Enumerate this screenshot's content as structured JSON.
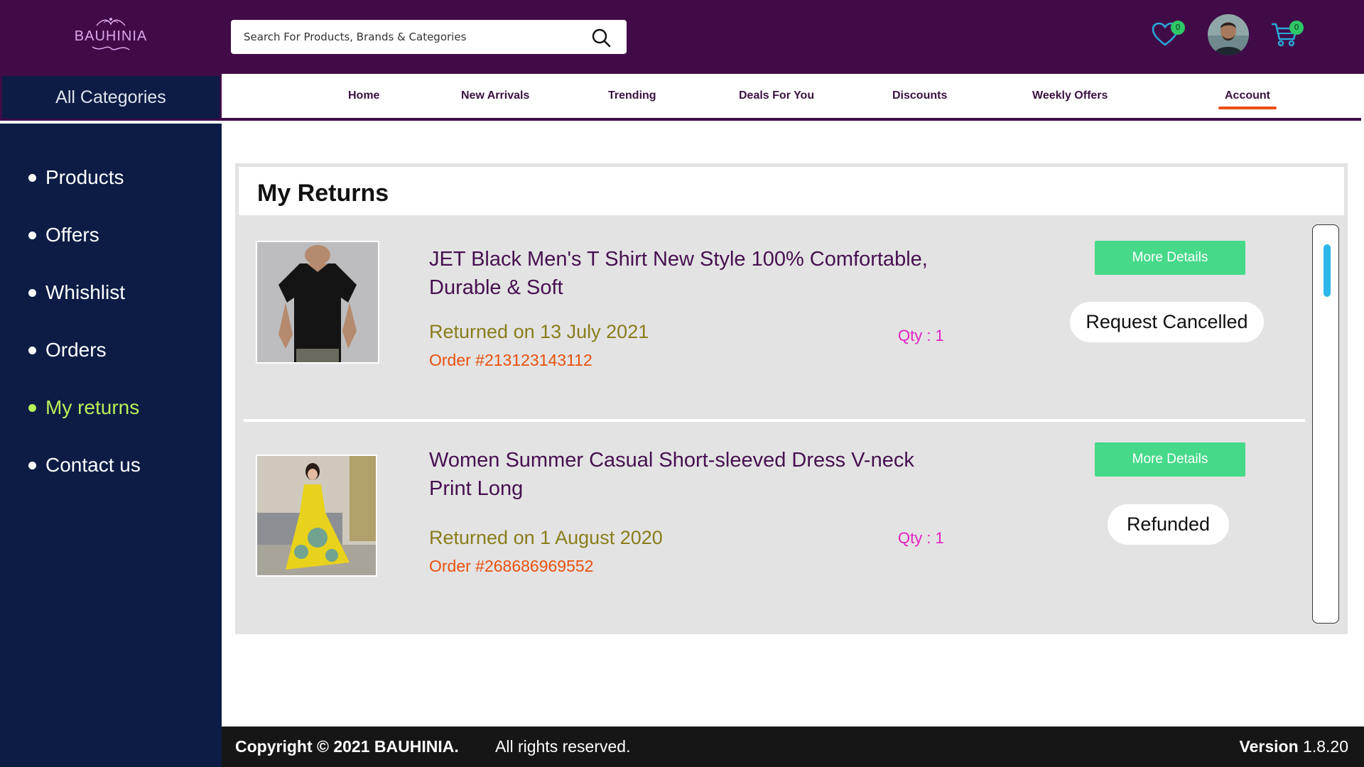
{
  "brand": {
    "name": "BAUHINIA"
  },
  "search": {
    "placeholder": "Search For Products, Brands & Categories"
  },
  "header": {
    "wishlist_count": "0",
    "cart_count": "0"
  },
  "all_categories": "All Categories",
  "nav": {
    "items": [
      "Home",
      "New Arrivals",
      "Trending",
      "Deals For You",
      "Discounts",
      "Weekly Offers",
      "Account"
    ],
    "active": "Account"
  },
  "sidebar": {
    "items": [
      "Products",
      "Offers",
      "Whishlist",
      "Orders",
      "My returns",
      "Contact us"
    ],
    "active": "My returns"
  },
  "returns": {
    "title": "My Returns",
    "items": [
      {
        "title": "JET Black Men's T Shirt New Style 100% Comfortable, Durable & Soft",
        "date": "Returned on 13 July 2021",
        "order": "Order #213123143112",
        "qty": "Qty : 1",
        "button": "More Details",
        "status": "Request Cancelled"
      },
      {
        "title": "Women Summer Casual Short-sleeved Dress V-neck Print Long",
        "date": "Returned on 1 August 2020",
        "order": "Order #268686969552",
        "qty": "Qty : 1",
        "button": "More Details",
        "status": "Refunded"
      }
    ]
  },
  "footer": {
    "copyright": "Copyright  ©  2021  BAUHINIA.",
    "rights": "All rights reserved.",
    "version_label": "Version",
    "version": "1.8.20"
  },
  "colors": {
    "header": "#410b48",
    "sidebar": "#0c1c45",
    "active_sidebar": "#b9ef59",
    "button": "#46d98a",
    "accent": "#ec4d15"
  }
}
